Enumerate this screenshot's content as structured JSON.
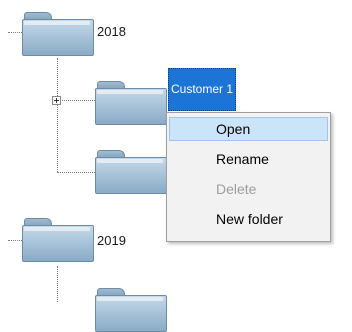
{
  "tree": {
    "nodes": [
      {
        "label": "2018",
        "icon": "folder-icon"
      },
      {
        "label": "Customer 1",
        "icon": "folder-icon",
        "selected": true
      },
      {
        "label": "",
        "icon": "folder-icon"
      },
      {
        "label": "2019",
        "icon": "folder-icon"
      },
      {
        "label": "",
        "icon": "folder-icon"
      }
    ],
    "expander_icon": "expand-plus-icon",
    "selection_color": "#1c74d6"
  },
  "context_menu": {
    "items": [
      {
        "label": "Open",
        "state": "highlighted"
      },
      {
        "label": "Rename",
        "state": "enabled"
      },
      {
        "label": "Delete",
        "state": "disabled"
      },
      {
        "label": "New folder",
        "state": "enabled"
      }
    ],
    "highlight_color": "#cce4f7"
  }
}
